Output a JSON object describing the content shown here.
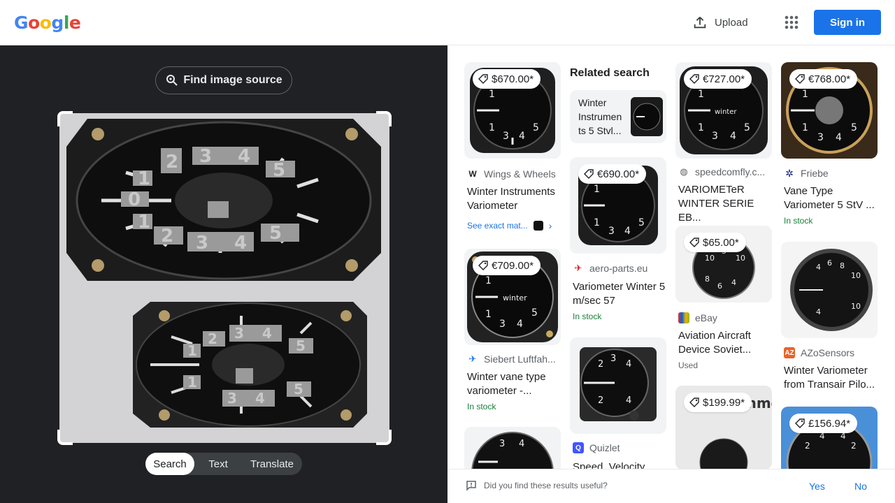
{
  "header": {
    "logo_letters": [
      {
        "ch": "G",
        "color": "#4285F4"
      },
      {
        "ch": "o",
        "color": "#EA4335"
      },
      {
        "ch": "o",
        "color": "#FBBC05"
      },
      {
        "ch": "g",
        "color": "#4285F4"
      },
      {
        "ch": "l",
        "color": "#34A853"
      },
      {
        "ch": "e",
        "color": "#EA4335"
      }
    ],
    "upload_label": "Upload",
    "apps_icon": "apps-grid-icon",
    "signin_label": "Sign in"
  },
  "left": {
    "find_source_label": "Find image source",
    "tabs": [
      "Search",
      "Text",
      "Translate"
    ],
    "active_tab": "Search"
  },
  "related": {
    "heading": "Related search",
    "card_text": "Winter Instrumen ts 5 Stvl..."
  },
  "results": [
    {
      "price": "$670.00*",
      "source": "Wings & Wheels",
      "title": "Winter Instruments Variometer"
    },
    {
      "price": "€709.00*",
      "source": "Siebert Luftfah...",
      "title": "Winter vane type variometer -...",
      "stock": "In stock"
    },
    {
      "price": "€690.00*",
      "source": "aero-parts.eu",
      "title": "Variometer Winter 5 m/sec 57",
      "stock": "In stock"
    },
    {
      "source": "Quizlet",
      "title": "Speed, Velocity"
    },
    {
      "price": "€727.00*",
      "source": "speedcomfly.c...",
      "title": "VARIOMETeR WINTER SERIE EB..."
    },
    {
      "price": "$65.00*",
      "source": "eBay",
      "title": "Aviation Aircraft Device Soviet...",
      "used": "Used"
    },
    {
      "price": "$199.99*"
    },
    {
      "price": "€768.00*",
      "source": "Friebe",
      "title": "Vane Type Variometer 5 StV ...",
      "stock": "In stock"
    },
    {
      "source": "AZoSensors",
      "title": "Winter Variometer from Transair Pilo..."
    },
    {
      "price": "£156.94*"
    }
  ],
  "exact_match_label": "See exact mat...",
  "feedback": {
    "question": "Did you find these results useful?",
    "yes": "Yes",
    "no": "No"
  }
}
